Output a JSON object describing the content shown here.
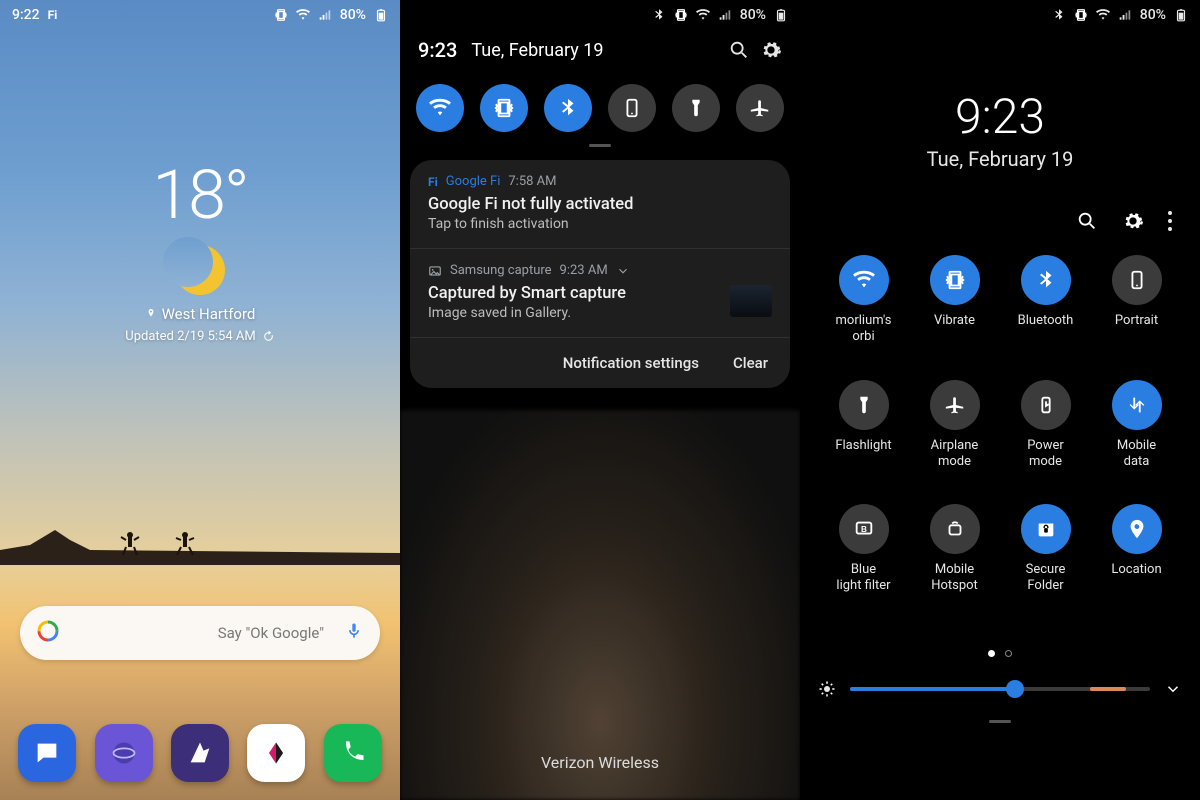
{
  "status": {
    "battery": "80%",
    "p1_time": "9:22",
    "p2_time": "9:23",
    "p3_time": "9:23"
  },
  "home": {
    "temperature": "18°",
    "location": "West Hartford",
    "updated": "Updated 2/19 5:54 AM",
    "search_placeholder": "Say \"Ok Google\"",
    "dock": [
      {
        "name": "messages-app",
        "bg": "#2a66e0"
      },
      {
        "name": "internet-app",
        "bg": "#6a55d6"
      },
      {
        "name": "galaxy-store-app",
        "bg": "#3c2e78"
      },
      {
        "name": "samsung-app",
        "bg": "#ffffff"
      },
      {
        "name": "phone-app",
        "bg": "#18b859"
      }
    ]
  },
  "shade": {
    "time": "9:23",
    "date": "Tue, February 19",
    "quick": [
      {
        "name": "wifi-toggle",
        "on": true,
        "icon": "wifi"
      },
      {
        "name": "vibrate-toggle",
        "on": true,
        "icon": "vibrate"
      },
      {
        "name": "bluetooth-toggle",
        "on": true,
        "icon": "bluetooth"
      },
      {
        "name": "rotation-toggle",
        "on": false,
        "icon": "portrait"
      },
      {
        "name": "flashlight-toggle",
        "on": false,
        "icon": "flashlight"
      },
      {
        "name": "airplane-toggle",
        "on": false,
        "icon": "airplane"
      }
    ],
    "notifs": [
      {
        "app": "Google Fi",
        "time": "7:58 AM",
        "title": "Google Fi not fully activated",
        "body": "Tap to finish activation"
      },
      {
        "app": "Samsung capture",
        "time": "9:23 AM",
        "title": "Captured by Smart capture",
        "body": "Image saved in Gallery."
      }
    ],
    "footer_settings": "Notification settings",
    "footer_clear": "Clear",
    "carrier": "Verizon Wireless"
  },
  "qs": {
    "time": "9:23",
    "date": "Tue, February 19",
    "tiles": [
      {
        "label": "morlium's orbi",
        "on": true,
        "icon": "wifi"
      },
      {
        "label": "Vibrate",
        "on": true,
        "icon": "vibrate"
      },
      {
        "label": "Bluetooth",
        "on": true,
        "icon": "bluetooth"
      },
      {
        "label": "Portrait",
        "on": false,
        "icon": "portrait"
      },
      {
        "label": "Flashlight",
        "on": false,
        "icon": "flashlight"
      },
      {
        "label": "Airplane mode",
        "on": false,
        "icon": "airplane"
      },
      {
        "label": "Power mode",
        "on": false,
        "icon": "power"
      },
      {
        "label": "Mobile data",
        "on": true,
        "icon": "data"
      },
      {
        "label": "Blue light filter",
        "on": false,
        "icon": "bluelight"
      },
      {
        "label": "Mobile Hotspot",
        "on": false,
        "icon": "hotspot"
      },
      {
        "label": "Secure Folder",
        "on": true,
        "icon": "secure"
      },
      {
        "label": "Location",
        "on": true,
        "icon": "location"
      }
    ],
    "brightness_pct": 55
  }
}
